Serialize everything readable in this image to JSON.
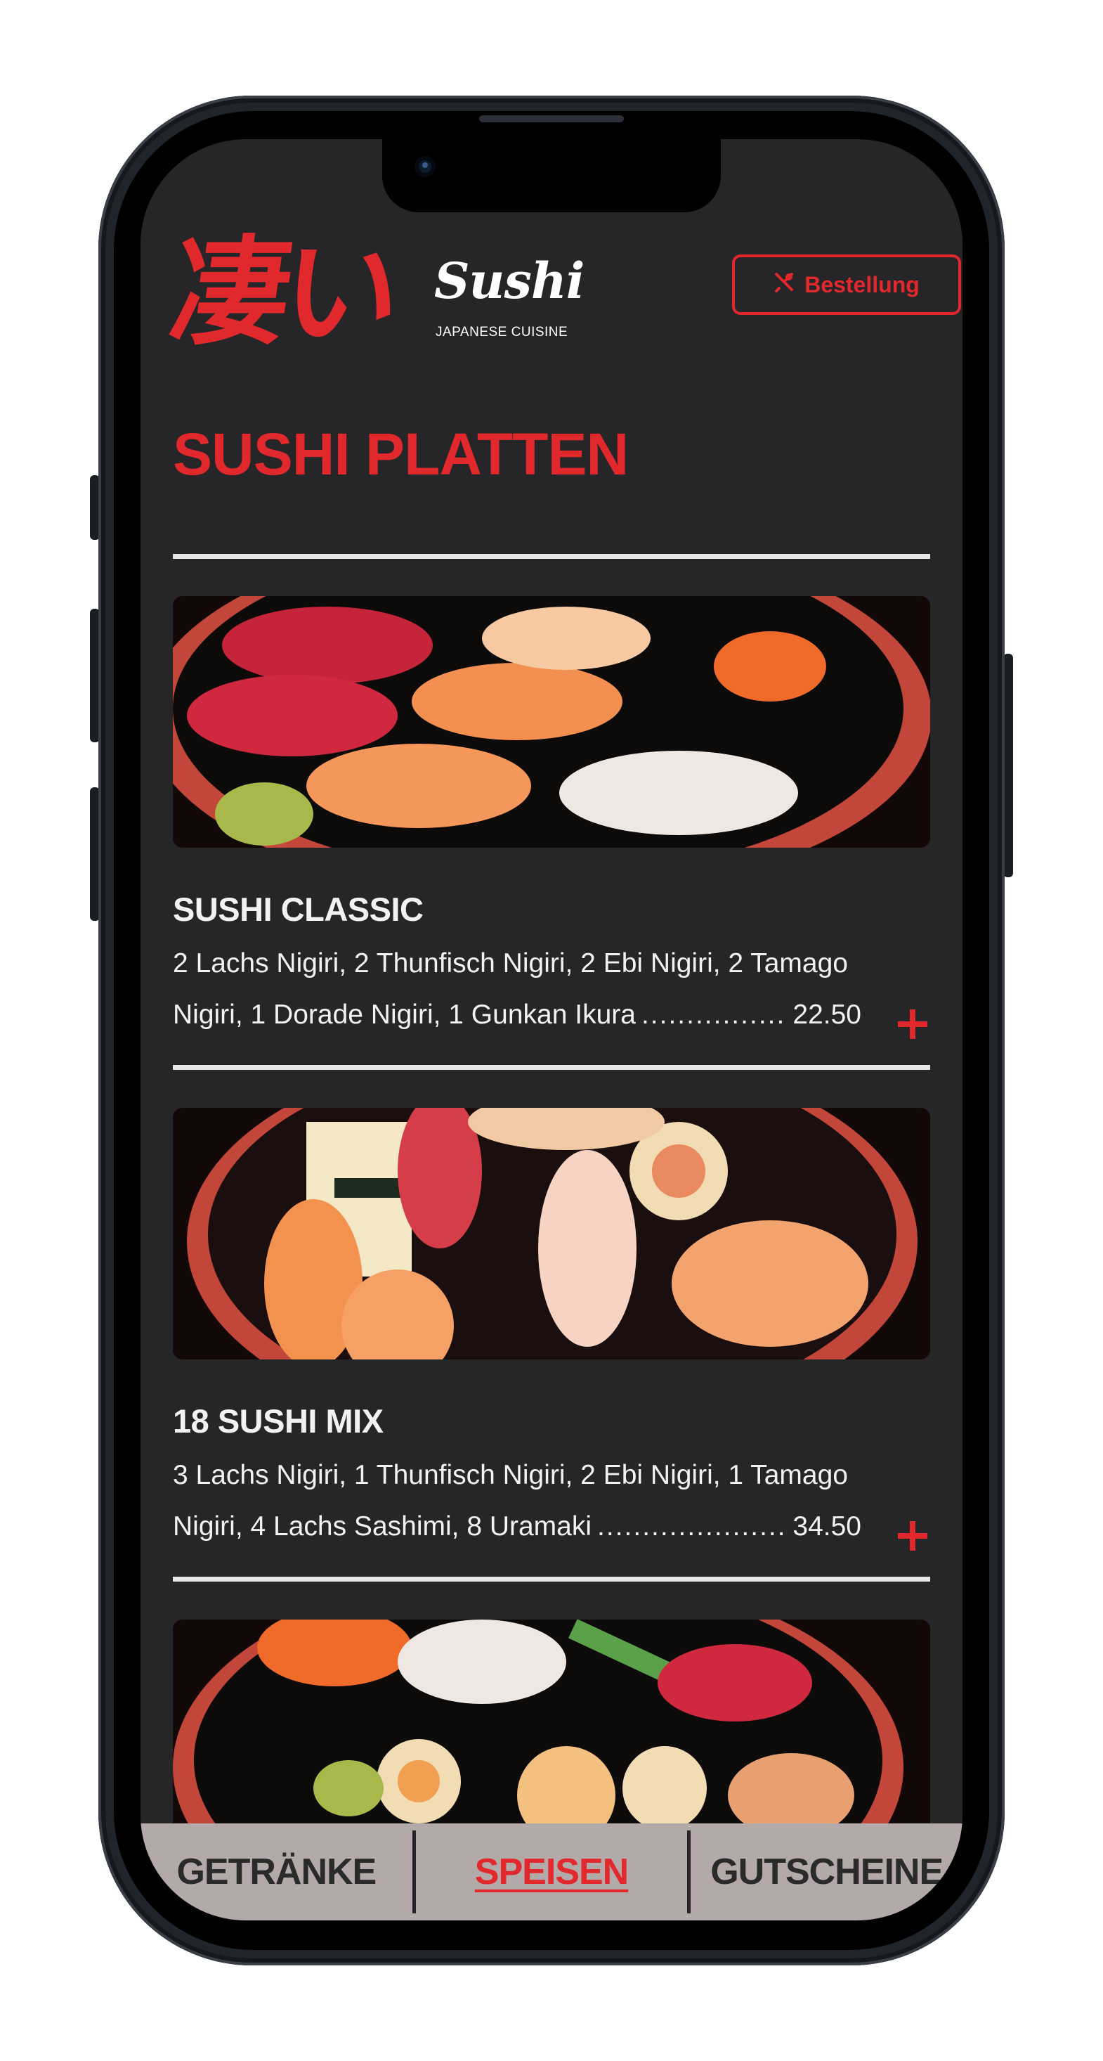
{
  "header": {
    "logo_kanji": "凄い",
    "logo_brand": "Sushi",
    "logo_subtitle": "JAPANESE CUISINE",
    "order_button_label": "Bestellung"
  },
  "section": {
    "title": "SUSHI PLATTEN"
  },
  "dishes": [
    {
      "name": "SUSHI CLASSIC",
      "desc_line1": "2 Lachs Nigiri, 2 Thunfisch Nigiri, 2 Ebi Nigiri, 2 Tamago",
      "desc_line2": "Nigiri, 1 Dorade Nigiri, 1 Gunkan Ikura",
      "dots": "....................................................",
      "price": "22.50"
    },
    {
      "name": "18 SUSHI MIX",
      "desc_line1": "3 Lachs Nigiri, 1 Thunfisch Nigiri, 2 Ebi Nigiri, 1 Tamago",
      "desc_line2": "Nigiri, 4 Lachs Sashimi, 8 Uramaki",
      "dots": "....................................................",
      "price": "34.50"
    }
  ],
  "bottom_nav": {
    "items": [
      {
        "label": "GETRÄNKE"
      },
      {
        "label": "SPEISEN"
      },
      {
        "label": "GUTSCHEINE"
      }
    ]
  },
  "colors": {
    "accent": "#e0282d",
    "background": "#262527",
    "nav_background": "#b3a9a9"
  }
}
